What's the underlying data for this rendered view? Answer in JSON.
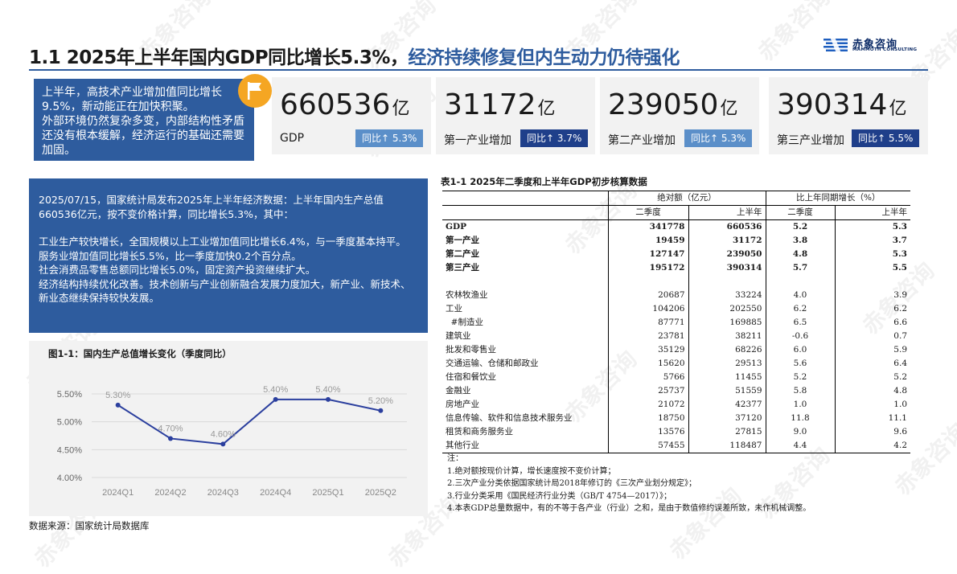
{
  "header": {
    "title_part1": "1.1 2025年上半年国内GDP同比增长5.3%，",
    "title_part2": "经济持续修复但内生动力仍待强化",
    "logo_cn": "赤象咨询",
    "logo_en": "MAMMOTH CONSULTING"
  },
  "info_box": {
    "p1": "上半年，高技术产业增加值同比增长9.5%，新动能正在加快积聚。",
    "p2": "外部环境仍然复杂多变，内部结构性矛盾还没有根本缓解，经济运行的基础还需要加固。"
  },
  "kpis": [
    {
      "value": "660536",
      "unit": "亿",
      "label": "GDP",
      "badge": "同比↑ 5.3%"
    },
    {
      "value": "31172",
      "unit": "亿",
      "label": "第一产业增加",
      "badge": "同比↑ 3.7%"
    },
    {
      "value": "239050",
      "unit": "亿",
      "label": "第二产业增加",
      "badge": "同比↑ 5.3%"
    },
    {
      "value": "390314",
      "unit": "亿",
      "label": "第三产业增加",
      "badge": "同比↑ 5.5%"
    }
  ],
  "news": {
    "p1": "2025/07/15，国家统计局发布2025年上半年经济数据：上半年国内生产总值660536亿元，按不变价格计算，同比增长5.3%，其中：",
    "p2": "工业生产较快增长，全国规模以上工业增加值同比增长6.4%，与一季度基本持平。",
    "p3": "服务业增加值同比增长5.5%，比一季度加快0.2个百分点。",
    "p4": "社会消费品零售总额同比增长5.0%，固定资产投资继续扩大。",
    "p5": "经济结构持续优化改善。技术创新与产业创新融合发展力度加大，新产业、新技术、新业态继续保持较快发展。"
  },
  "chart_title": "图1-1：国内生产总值增长变化（季度同比）",
  "chart_data": {
    "type": "line",
    "title": "图1-1：国内生产总值增长变化（季度同比）",
    "categories": [
      "2024Q1",
      "2024Q2",
      "2024Q3",
      "2024Q4",
      "2025Q1",
      "2025Q2"
    ],
    "values": [
      5.3,
      4.7,
      4.6,
      5.4,
      5.4,
      5.2
    ],
    "value_labels": [
      "5.30%",
      "4.70%",
      "4.60%",
      "5.40%",
      "5.40%",
      "5.20%"
    ],
    "yticks": [
      "4.00%",
      "4.50%",
      "5.00%",
      "5.50%"
    ],
    "ylim": [
      4.0,
      5.5
    ],
    "grid": true,
    "line_color": "#2b3f9e"
  },
  "source": "数据来源：国家统计局数据库",
  "table": {
    "title": "表1-1   2025年二季度和上半年GDP初步核算数据",
    "group_abs": "绝对额（亿元）",
    "group_growth": "比上年同期增长（%）",
    "sub_q2": "二季度",
    "sub_h1": "上半年",
    "sub_q2b": "二季度",
    "sub_h1b": "上半年",
    "rows": [
      {
        "name": "GDP",
        "q2": "341778",
        "h1": "660536",
        "gq2": "5.2",
        "gh1": "5.3",
        "bold": true
      },
      {
        "name": "第一产业",
        "q2": "19459",
        "h1": "31172",
        "gq2": "3.8",
        "gh1": "3.7",
        "bold": true
      },
      {
        "name": "第二产业",
        "q2": "127147",
        "h1": "239050",
        "gq2": "4.8",
        "gh1": "5.3",
        "bold": true
      },
      {
        "name": "第三产业",
        "q2": "195172",
        "h1": "390314",
        "gq2": "5.7",
        "gh1": "5.5",
        "bold": true
      },
      {
        "name": "",
        "q2": "",
        "h1": "",
        "gq2": "",
        "gh1": "",
        "bold": false
      },
      {
        "name": "农林牧渔业",
        "q2": "20687",
        "h1": "33224",
        "gq2": "4.0",
        "gh1": "3.9",
        "bold": false
      },
      {
        "name": "工业",
        "q2": "104206",
        "h1": "202550",
        "gq2": "6.2",
        "gh1": "6.2",
        "bold": false
      },
      {
        "name": "  #制造业",
        "q2": "87771",
        "h1": "169885",
        "gq2": "6.5",
        "gh1": "6.6",
        "bold": false
      },
      {
        "name": "建筑业",
        "q2": "23781",
        "h1": "38211",
        "gq2": "-0.6",
        "gh1": "0.7",
        "bold": false
      },
      {
        "name": "批发和零售业",
        "q2": "35129",
        "h1": "68226",
        "gq2": "6.0",
        "gh1": "5.9",
        "bold": false
      },
      {
        "name": "交通运输、仓储和邮政业",
        "q2": "15620",
        "h1": "29513",
        "gq2": "5.6",
        "gh1": "6.4",
        "bold": false
      },
      {
        "name": "住宿和餐饮业",
        "q2": "5766",
        "h1": "11455",
        "gq2": "5.2",
        "gh1": "5.2",
        "bold": false
      },
      {
        "name": "金融业",
        "q2": "25737",
        "h1": "51559",
        "gq2": "5.8",
        "gh1": "4.8",
        "bold": false
      },
      {
        "name": "房地产业",
        "q2": "21072",
        "h1": "42377",
        "gq2": "1.0",
        "gh1": "1.0",
        "bold": false
      },
      {
        "name": "信息传输、软件和信息技术服务业",
        "q2": "18750",
        "h1": "37120",
        "gq2": "11.8",
        "gh1": "11.1",
        "bold": false
      },
      {
        "name": "租赁和商务服务业",
        "q2": "13576",
        "h1": "27815",
        "gq2": "9.0",
        "gh1": "9.6",
        "bold": false
      },
      {
        "name": "其他行业",
        "q2": "57455",
        "h1": "118487",
        "gq2": "4.4",
        "gh1": "4.2",
        "bold": false
      }
    ]
  },
  "notes": [
    "注：",
    "1.绝对额按现价计算，增长速度按不变价计算；",
    "2.三次产业分类依据国家统计局2018年修订的《三次产业划分规定》；",
    "3.行业分类采用《国民经济行业分类（GB/T 4754—2017）》；",
    "4.本表GDP总量数据中，有的不等于各产业（行业）之和，是由于数值修约误差所致，未作机械调整。"
  ],
  "watermark": "赤象咨询",
  "colors": {
    "brand_blue": "#2e5c9e",
    "badge_light": "#5b8fc9",
    "badge_dark": "#1f3f8a",
    "flag_orange": "#f5a623"
  }
}
